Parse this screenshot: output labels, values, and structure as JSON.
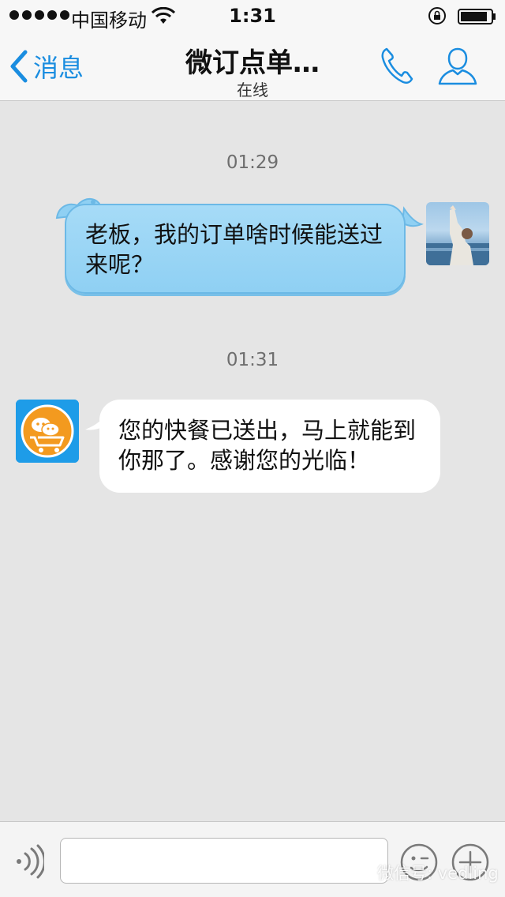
{
  "status_bar": {
    "carrier": "中国移动",
    "time": "1:31"
  },
  "nav": {
    "back_label": "消息",
    "title": "微订点单…",
    "subtitle": "在线",
    "call_icon": "phone-icon",
    "profile_icon": "person-icon"
  },
  "messages": [
    {
      "timestamp": "01:29",
      "direction": "outgoing",
      "text": "老板，我的订单啥时候能送过来呢？"
    },
    {
      "timestamp": "01:31",
      "direction": "incoming",
      "text": "您的快餐已送出，马上就能到你那了。感谢您的光临！"
    }
  ],
  "input_bar": {
    "value": "",
    "voice_icon": "voice-icon",
    "emoji_icon": "emoji-icon",
    "plus_icon": "plus-icon"
  },
  "watermark": "微信号: vedling",
  "colors": {
    "accent": "#1a8de0",
    "outgoing_bubble": "#9ad5f5",
    "incoming_bubble": "#ffffff",
    "background": "#e5e5e5"
  }
}
